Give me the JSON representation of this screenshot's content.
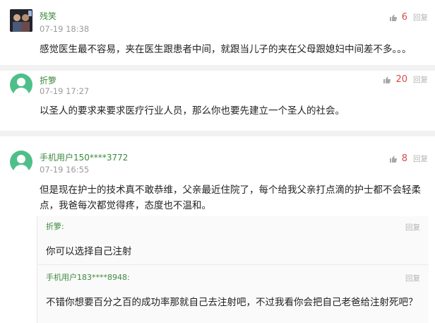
{
  "comments": [
    {
      "username": "残笑",
      "time": "07-19 18:38",
      "likes": "6",
      "reply_label": "回复",
      "avatar": "user-photo",
      "text": "感觉医生最不容易，夹在医生跟患者中间，就跟当儿子的夹在父母跟媳妇中间差不多。。。"
    },
    {
      "username": "折箩",
      "time": "07-19 17:27",
      "likes": "20",
      "reply_label": "回复",
      "avatar": "default-user-icon",
      "text": "以圣人的要求来要求医疗行业人员，那么你也要先建立一个圣人的社会。"
    },
    {
      "username": "手机用户150****3772",
      "time": "07-19 16:55",
      "likes": "8",
      "reply_label": "回复",
      "avatar": "default-user-icon",
      "text_lines": [
        "但是现在护士的技术真不敢恭维，父亲最近住院了，每个给我父亲打点滴的护士都不会轻柔",
        "点，我爸每次都觉得疼，态度也不温和。"
      ],
      "replies": [
        {
          "username": "折箩:",
          "reply_label": "回复",
          "text": "你可以选择自己注射"
        },
        {
          "username": "手机用户183****8948:",
          "reply_label": "回复",
          "text": "不错你想要百分之百的成功率那就自己去注射吧，不过我看你会把自己老爸给注射死吧？"
        }
      ]
    }
  ],
  "colors": {
    "username": "#3c8a3c",
    "likes": "#d84a4a",
    "muted": "#9a9a9a",
    "avatar_green": "#4fbf8a"
  }
}
